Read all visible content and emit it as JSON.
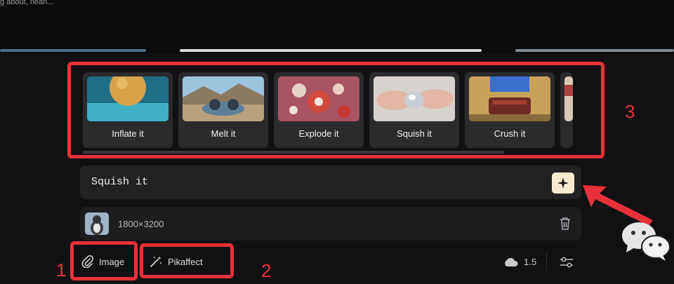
{
  "top_text": "g about, nean...",
  "effects": [
    {
      "label": "Inflate it"
    },
    {
      "label": "Melt it"
    },
    {
      "label": "Explode it"
    },
    {
      "label": "Squish it"
    },
    {
      "label": "Crush it"
    }
  ],
  "prompt": {
    "value": "Squish it"
  },
  "attachment": {
    "dimensions": "1800×3200"
  },
  "toolbar": {
    "image_label": "Image",
    "pikaffect_label": "Pikaffect",
    "credits_value": "1.5"
  },
  "annotations": {
    "one": "1",
    "two": "2",
    "three": "3"
  },
  "colors": {
    "annotation_red": "#e8313a",
    "enhance_button": "#f6ead0",
    "panel": "#111113"
  }
}
